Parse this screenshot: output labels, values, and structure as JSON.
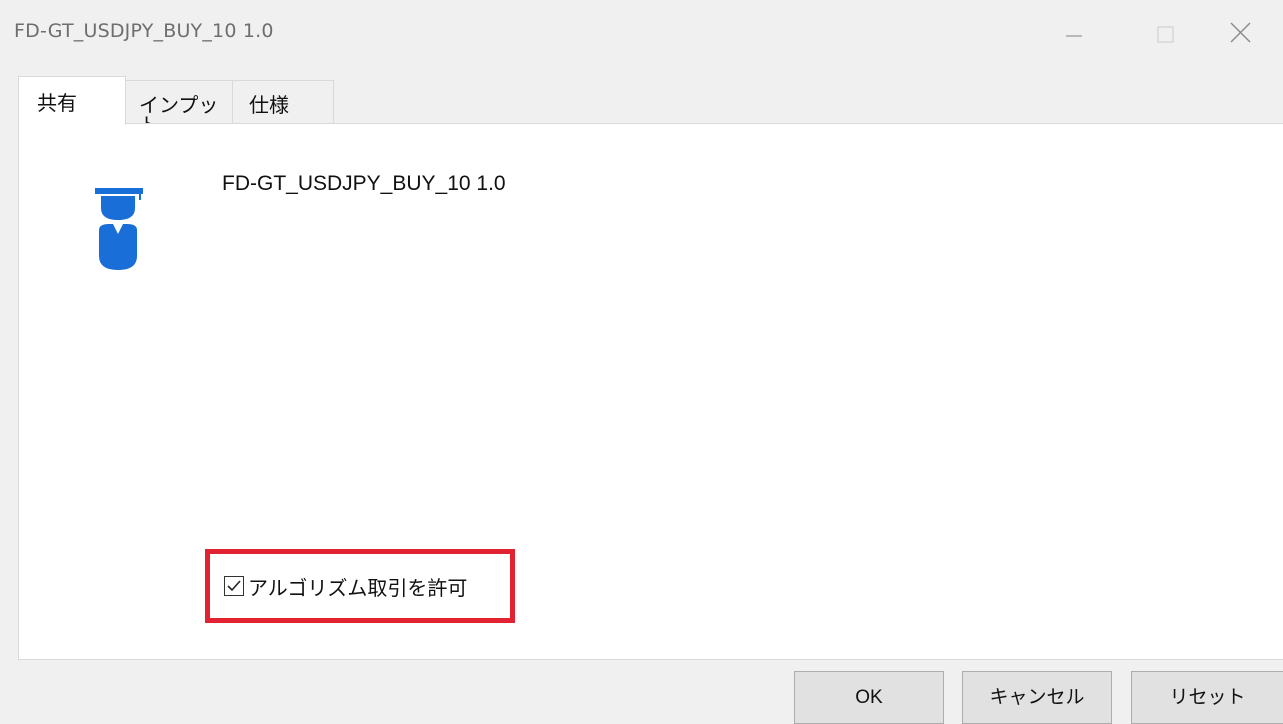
{
  "window": {
    "title": "FD-GT_USDJPY_BUY_10 1.0"
  },
  "tabs": [
    {
      "label": "共有",
      "active": true
    },
    {
      "label": "インプット",
      "active": false
    },
    {
      "label": "仕様",
      "active": false
    }
  ],
  "common": {
    "ea_name": "FD-GT_USDJPY_BUY_10 1.0",
    "allow_algo_trading": {
      "label": "アルゴリズム取引を許可",
      "checked": true
    }
  },
  "buttons": {
    "ok": "OK",
    "cancel": "キャンセル",
    "reset": "リセット"
  },
  "colors": {
    "highlight": "#e02231",
    "icon_blue": "#1a6ed8"
  },
  "icons": {
    "ea": "graduate-expert-icon",
    "minimize": "minimize-icon",
    "maximize": "maximize-icon",
    "close": "close-icon",
    "check": "check-icon"
  }
}
